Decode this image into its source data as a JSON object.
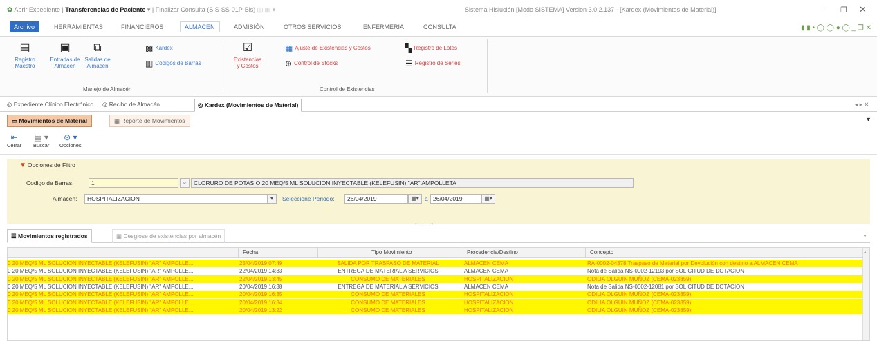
{
  "titlebar": {
    "quick_access": [
      "Abrir Expediente",
      "Transferencias de Paciente",
      "Finalizar Consulta (SIS-SS-01P-Bis)"
    ],
    "app_title": "Sistema Hislución [Modo SISTEMA] Version 3.0.2.137 - [Kardex (Movimientos de Material)]",
    "minimize": "–",
    "restore": "❐",
    "close": "✕"
  },
  "ribbon_tabs": {
    "file": "Archivo",
    "tabs": [
      "HERRAMIENTAS",
      "FINANCIEROS",
      "ALMACEN",
      "ADMISIÓN",
      "OTROS SERVICIOS",
      "ENFERMERIA",
      "CONSULTA"
    ],
    "active": "ALMACEN",
    "right_indicators": "▮ ▮  • ◯ ◯ ● ◯ _ ❐ ✕"
  },
  "ribbon": {
    "registro": "Registro Maestro",
    "entradas": "Entradas de Almacén",
    "salidas": "Salidas de Almacén",
    "kardex": "Kardex",
    "codigos": "Códigos de Barras",
    "group1": "Manejo de Almacén",
    "existencias_costos": "Existencias y Costos",
    "ajuste": "Ajuste de Existencias y Costos",
    "control_stocks": "Control de Stocks",
    "registro_lotes": "Registro de Lotes",
    "registro_series": "Registro de Series",
    "group2": "Control de Existencias"
  },
  "doctabs": {
    "items": [
      "Expediente Clínico Electrónico",
      "Recibo de Almacén",
      "Kardex (Movimientos de Material)"
    ],
    "right": "◂ ▸ ✕"
  },
  "subtabs": {
    "movimientos": "Movimientos de Material",
    "reporte": "Reporte de Movimientos"
  },
  "toolbar": {
    "cerrar": "Cerrar",
    "buscar": "Buscar",
    "opciones": "Opciones"
  },
  "filters": {
    "title": "Opciones de Filtro",
    "barcode_label": "Codigo de Barras:",
    "barcode_value": "1",
    "product_description": "CLORURO DE POTASIO 20 MEQ/5 ML SOLUCION INYECTABLE (KELEFUSIN) \"AR\" AMPOLLETA",
    "almacen_label": "Almacen:",
    "almacen_value": "HOSPITALIZACION",
    "periodo_label": "Seleccione Periodo:",
    "fecha_inicio": "26/04/2019",
    "fecha_fin": "26/04/2019",
    "separator": "a"
  },
  "gridtabs": {
    "registrados": "Movimientos registrados",
    "desglose": "Desglose de existencias por almacén"
  },
  "grid": {
    "columns": [
      "",
      "Fecha",
      "Tipo Movimiento",
      "Procedencia/Destino",
      "Concepto"
    ],
    "rows": [
      {
        "hl": true,
        "producto": "0 20 MEQ/5 ML SOLUCION INYECTABLE (KELEFUSIN) \"AR\" AMPOLLE...",
        "fecha": "25/04/2019 07:49",
        "tipo": "SALIDA POR TRASPASO DE MATERIAL",
        "destino": "ALMACEN CEMA",
        "concepto": "RA-0002-04378 Traspaso de Material por Devolución con destino a ALMACEN CEMA"
      },
      {
        "hl": false,
        "producto": "0 20 MEQ/5 ML SOLUCION INYECTABLE (KELEFUSIN) \"AR\" AMPOLLE...",
        "fecha": "22/04/2019 14:33",
        "tipo": "ENTREGA DE MATERIAL A SERVICIOS",
        "destino": "ALMACEN CEMA",
        "concepto": "Nota de Salida NS-0002-12193 por SOLICITUD DE DOTACION"
      },
      {
        "hl": true,
        "producto": "0 20 MEQ/5 ML SOLUCION INYECTABLE (KELEFUSIN) \"AR\" AMPOLLE...",
        "fecha": "22/04/2019 13:45",
        "tipo": "CONSUMO DE MATERIALES",
        "destino": "HOSPITALIZACION",
        "concepto": "ODILIA OLGUIN MUÑOZ (CEMA-023859)"
      },
      {
        "hl": false,
        "producto": "0 20 MEQ/5 ML SOLUCION INYECTABLE (KELEFUSIN) \"AR\" AMPOLLE...",
        "fecha": "20/04/2019 16:38",
        "tipo": "ENTREGA DE MATERIAL A SERVICIOS",
        "destino": "ALMACEN CEMA",
        "concepto": "Nota de Salida NS-0002-12081 por SOLICITUD DE DOTACION"
      },
      {
        "hl": true,
        "producto": "0 20 MEQ/5 ML SOLUCION INYECTABLE (KELEFUSIN) \"AR\" AMPOLLE...",
        "fecha": "20/04/2019 16:35",
        "tipo": "CONSUMO DE MATERIALES",
        "destino": "HOSPITALIZACION",
        "concepto": "ODILIA OLGUIN MUÑOZ (CEMA-023859)"
      },
      {
        "hl": true,
        "producto": "0 20 MEQ/5 ML SOLUCION INYECTABLE (KELEFUSIN) \"AR\" AMPOLLE...",
        "fecha": "20/04/2019 16:34",
        "tipo": "CONSUMO DE MATERIALES",
        "destino": "HOSPITALIZACION",
        "concepto": "ODILIA OLGUIN MUÑOZ (CEMA-023859)"
      },
      {
        "hl": true,
        "producto": "0 20 MEQ/5 ML SOLUCION INYECTABLE (KELEFUSIN) \"AR\" AMPOLLE...",
        "fecha": "20/04/2019 13:22",
        "tipo": "CONSUMO DE MATERIALES",
        "destino": "HOSPITALIZACION",
        "concepto": "ODILIA OLGUIN MUÑOZ (CEMA-023859)"
      }
    ]
  },
  "colors": {
    "accent": "#2e6ec6",
    "highlight_row": "#fff700",
    "highlight_text": "#ff6a1a",
    "filter_panel": "#f9f4d3",
    "active_subtab": "#f3c9a7"
  }
}
